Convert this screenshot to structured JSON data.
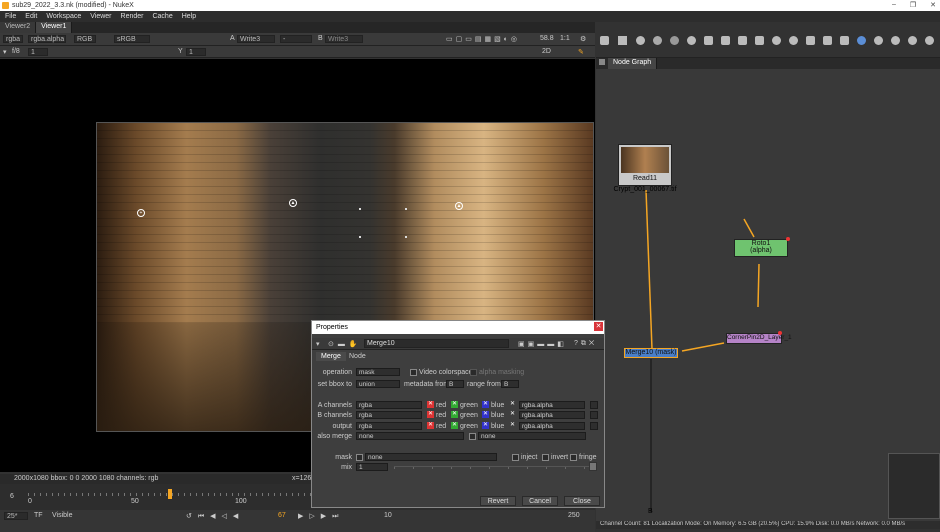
{
  "window": {
    "title": "sub29_2022_3.3.nk (modified) - NukeX",
    "controls": [
      "–",
      "❐",
      "✕"
    ]
  },
  "menu": [
    "File",
    "Edit",
    "Workspace",
    "Viewer",
    "Render",
    "Cache",
    "Help"
  ],
  "viewer": {
    "tabs": [
      "Viewer2",
      "Viewer1"
    ],
    "toolbar1": {
      "channels": "rgba",
      "alpha": "rgba.alpha",
      "colorspace_rgb": "RGB",
      "lut": "sRGB",
      "a_label": "A",
      "a_input": "Write3",
      "dash": "-",
      "b_label": "B",
      "b_input": "Write3",
      "zoom": "58.8",
      "ratio": "1:1",
      "view": "2D"
    },
    "toolbar2": {
      "fstop": "f/8",
      "fstop_value": "1",
      "y_label": "Y",
      "y_value": "1"
    },
    "status_left": "2000x1080  bbox: 0 0 2000 1080 channels: rgb",
    "status_right": "x=1267",
    "timeline": {
      "ticks": [
        "0",
        "50",
        "100"
      ],
      "current": "6"
    },
    "transport": {
      "fps": "25*",
      "tf": "TF",
      "visible": "Visible",
      "frame": "67",
      "inc": "10",
      "end": "250"
    }
  },
  "nodegraph": {
    "tab": "Node Graph",
    "nodes": {
      "read": "Read11",
      "read_file": "Crypt_001_00067.tif",
      "roto": "Roto1",
      "roto_sub": "(alpha)",
      "corner": "CornerPin2D_Layer_1",
      "merge": "Merge10 (mask)",
      "b_input": "B"
    },
    "status": "Channel Count: 81  Localization Mode: On  Memory: 6.5 GB (20.5%)  CPU: 15.9%  Disk: 0.0 MB/s  Network: 0.0 MB/s"
  },
  "properties": {
    "title": "Properties",
    "node_name": "Merge10",
    "tabs": [
      "Merge",
      "Node"
    ],
    "operation": {
      "label": "operation",
      "value": "mask"
    },
    "video_colorspace": "Video colorspace",
    "alpha_masking": "alpha masking",
    "set_bbox": {
      "label": "set bbox to",
      "value": "union"
    },
    "metadata_from": {
      "label": "metadata from",
      "value": "B"
    },
    "range_from": {
      "label": "range from",
      "value": "B"
    },
    "a_channels": {
      "label": "A channels",
      "value": "rgba",
      "alpha": "rgba.alpha"
    },
    "b_channels": {
      "label": "B channels",
      "value": "rgba",
      "alpha": "rgba.alpha"
    },
    "output": {
      "label": "output",
      "value": "rgba",
      "alpha": "rgba.alpha"
    },
    "also_merge": {
      "label": "also merge",
      "value": "none",
      "value2": "none"
    },
    "ch_red": "red",
    "ch_green": "green",
    "ch_blue": "blue",
    "mask": {
      "label": "mask",
      "value": "none",
      "inject": "inject",
      "invert": "invert",
      "fringe": "fringe"
    },
    "mix": {
      "label": "mix",
      "value": "1"
    },
    "buttons": {
      "revert": "Revert",
      "cancel": "Cancel",
      "close": "Close"
    }
  }
}
